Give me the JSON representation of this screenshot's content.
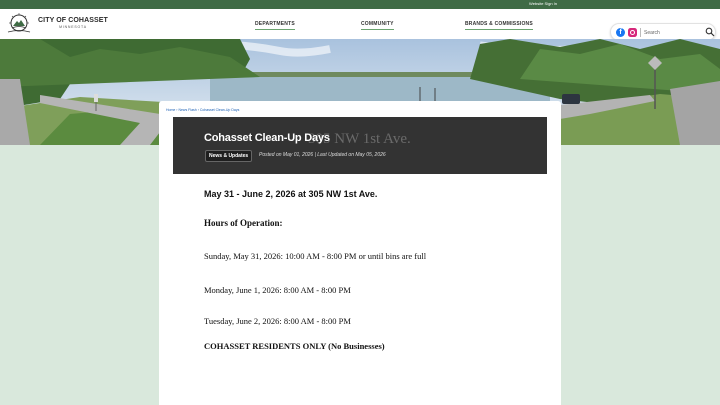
{
  "topbar": {
    "signin": "Website Sign In"
  },
  "brand": {
    "name": "CITY OF COHASSET",
    "state": "MINNESOTA"
  },
  "nav": {
    "items": [
      {
        "label": "DEPARTMENTS"
      },
      {
        "label": "COMMUNITY"
      },
      {
        "label": "BRANDS & COMMISSIONS"
      }
    ]
  },
  "search": {
    "placeholder": "Search"
  },
  "social": {
    "facebook": "f"
  },
  "breadcrumb": "Home › News Flash › Cohasset Clean-Up Days",
  "article": {
    "ghost_text": "305 NW 1st Ave.",
    "title": "Cohasset Clean-Up Days",
    "category": "News & Updates",
    "posted": "Posted on May 01, 2026 | Last Updated on May 05, 2026",
    "dates": "May 31 - June 2, 2026 at 305 NW 1st Ave.",
    "hours_heading": "Hours of Operation:",
    "line1": "Sunday, May 31, 2026: 10:00 AM - 8:00 PM or until bins are full",
    "line2": "Monday, June 1, 2026: 8:00 AM - 8:00 PM",
    "line3": "Tuesday, June 2, 2026: 8:00 AM - 8:00 PM",
    "residents": "COHASSET RESIDENTS ONLY (No Businesses)"
  },
  "colors": {
    "topbar": "#3f6b45",
    "page_bg": "#d9e8dc",
    "title_bg": "#333333",
    "nav_underline": "#6aa36e",
    "link": "#1a5fb4"
  },
  "icons": {
    "logo": "city-seal-icon",
    "facebook": "facebook-icon",
    "instagram": "instagram-icon",
    "search": "search-icon"
  }
}
